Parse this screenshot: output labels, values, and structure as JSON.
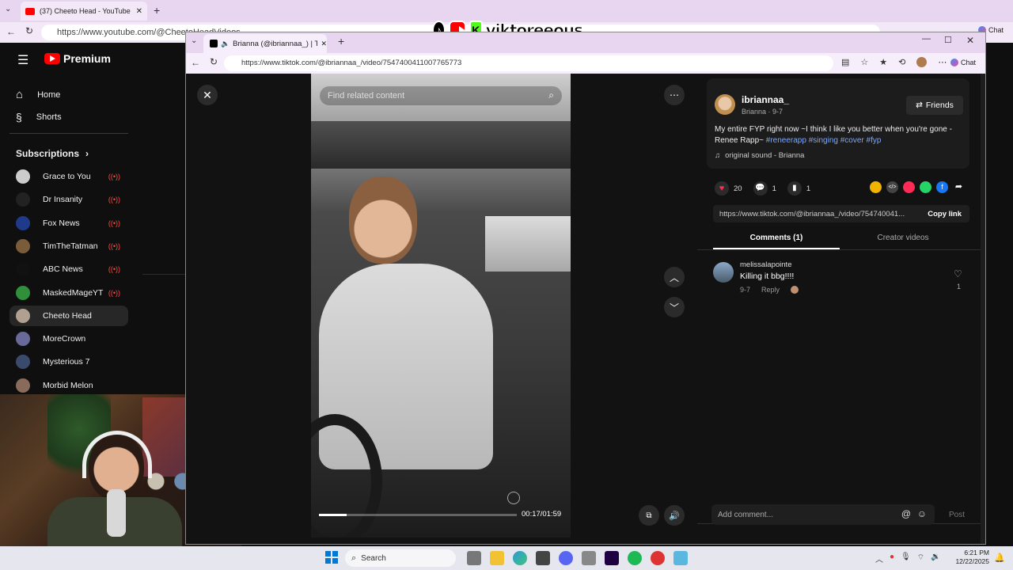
{
  "youtube": {
    "tab_title": "(37) Cheeto Head - YouTube",
    "url": "https://www.youtube.com/@CheetoHeadVideos",
    "brand": "Premium",
    "nav": [
      {
        "label": "Home",
        "icon": "home-icon"
      },
      {
        "label": "Shorts",
        "icon": "shorts-icon"
      }
    ],
    "subscriptions_label": "Subscriptions",
    "subscriptions": [
      {
        "label": "Grace to You",
        "live": true,
        "color": "#cccccc"
      },
      {
        "label": "Dr Insanity",
        "live": true,
        "color": "#222222"
      },
      {
        "label": "Fox News",
        "live": true,
        "color": "#1f3a8a"
      },
      {
        "label": "TimTheTatman",
        "live": true,
        "color": "#7a5c3a"
      },
      {
        "label": "ABC News",
        "live": true,
        "color": "#111111"
      },
      {
        "label": "MaskedMageYT",
        "live": true,
        "color": "#2f8f3a"
      },
      {
        "label": "Cheeto Head",
        "live": false,
        "color": "#b0a090"
      },
      {
        "label": "MoreCrown",
        "live": false,
        "color": "#6a6a9a"
      },
      {
        "label": "Mysterious 7",
        "live": false,
        "color": "#3a4a6a"
      },
      {
        "label": "Morbid Melon",
        "live": false,
        "color": "#8a6a5a"
      }
    ],
    "chat_label": "Chat"
  },
  "overlay": {
    "text": "viktoreeous"
  },
  "tiktok": {
    "tab_title": "Brianna (@ibriannaa_) | TikTok",
    "url": "https://www.tiktok.com/@ibriannaa_/video/7547400411007765773",
    "chat_label": "Chat",
    "search_placeholder": "Find related content",
    "time": "00:17/01:59",
    "progress": 0.14,
    "author_handle": "ibriannaa_",
    "author_sub": "Brianna · 9-7",
    "friends_label": "Friends",
    "caption": "My entire FYP right now ~I think I like you better when you're gone - Renee Rapp~",
    "hashtags": "#reneerapp #singing #cover #fyp",
    "sound": "original sound - Brianna",
    "likes": "20",
    "comments_count": "1",
    "saves": "1",
    "share_url": "https://www.tiktok.com/@ibriannaa_/video/754740041...",
    "copy_link": "Copy link",
    "tab_comments": "Comments (1)",
    "tab_creator": "Creator videos",
    "comment": {
      "user": "melissalapointe",
      "text": "Killing it bbg!!!!",
      "date": "9-7",
      "reply": "Reply",
      "likes": "1"
    },
    "add_comment_placeholder": "Add comment...",
    "post_label": "Post"
  },
  "taskbar": {
    "search_placeholder": "Search",
    "time": "6:21 PM",
    "date": "12/22/2025"
  },
  "colors": {
    "youtube_red": "#ff0000",
    "tiktok_pink": "#fe2c55",
    "hashtag_blue": "#7ba7ff",
    "tab_lavender": "#e8d5f0"
  }
}
